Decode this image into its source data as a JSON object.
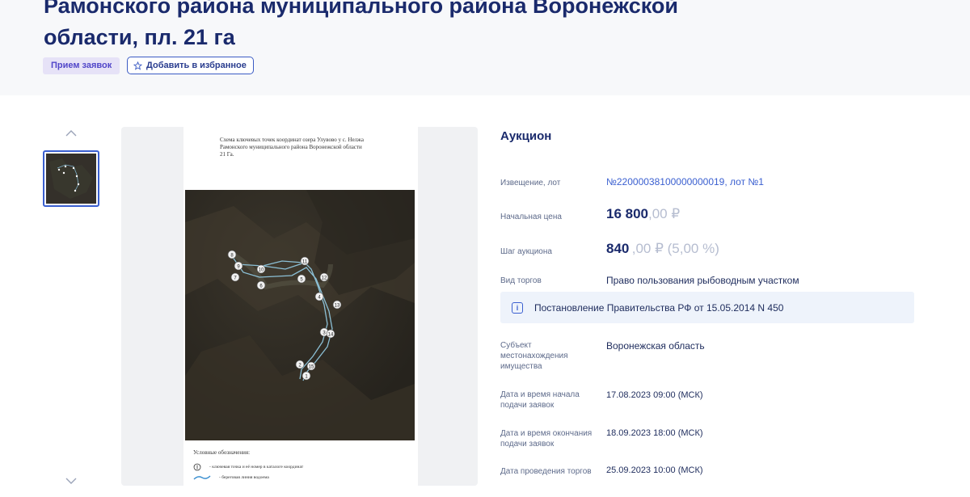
{
  "header": {
    "title_line1": "Рамонского района муниципального района Воронежской",
    "title_line2": "области, пл. 21 га",
    "status_badge": "Прием заявок",
    "favorite_button": "Добавить в избранное"
  },
  "document": {
    "caption_line1": "Схема ключевых точек координат озера Улувово у с. Нелжа",
    "caption_line2": "Рамонского муниципального района Воронежской области",
    "caption_line3": "21 Га.",
    "legend_title": "Условные обозначения:",
    "legend_item1": "- ключевая точка и её номер в каталоге координат",
    "legend_item2": "- береговая линия водоема",
    "points": [
      "1",
      "2",
      "3",
      "4",
      "5",
      "6",
      "7",
      "8",
      "9",
      "10",
      "11",
      "12",
      "13",
      "14",
      "15"
    ]
  },
  "info": {
    "title": "Аукцион",
    "notice_label": "Извещение, лот",
    "notice_value": "№22000038100000000019, лот №1",
    "start_price_label": "Начальная цена",
    "start_price_main": "16 800",
    "start_price_dim": ",00 ₽",
    "step_label": "Шаг аукциона",
    "step_main": "840",
    "step_dim": ",00 ₽ (5,00 %)",
    "type_label": "Вид торгов",
    "type_value": "Право пользования рыбоводным участком",
    "decree": "Постановление Правительства РФ от 15.05.2014 N 450",
    "subject_label": "Субъект местонахождения имущества",
    "subject_value": "Воронежская область",
    "start_date_label": "Дата и время начала подачи заявок",
    "start_date_value": "17.08.2023 09:00 (МСК)",
    "end_date_label": "Дата и время окончания подачи заявок",
    "end_date_value": "18.09.2023 18:00 (МСК)",
    "auction_date_label": "Дата проведения торгов",
    "auction_date_value": "25.09.2023 10:00 (МСК)"
  },
  "colors": {
    "accent": "#3a5fd0",
    "title": "#1a2a6c",
    "badge_bg": "#e6e2f7",
    "notice_bg": "#eef3fb"
  }
}
